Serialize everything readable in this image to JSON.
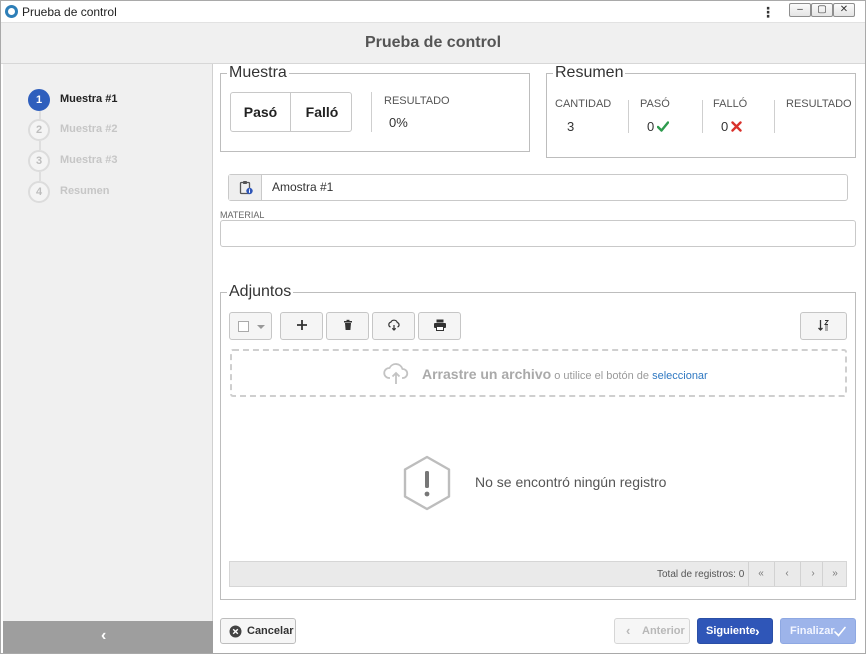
{
  "window": {
    "title": "Prueba de control"
  },
  "header": {
    "title": "Prueba de control"
  },
  "steps": [
    {
      "number": "1",
      "label": "Muestra #1"
    },
    {
      "number": "2",
      "label": "Muestra #2"
    },
    {
      "number": "3",
      "label": "Muestra #3"
    },
    {
      "number": "4",
      "label": "Resumen"
    }
  ],
  "muestra": {
    "legend": "Muestra",
    "pass_label": "Pasó",
    "fail_label": "Falló",
    "result_caption": "RESULTADO",
    "result_value": "0%"
  },
  "resumen": {
    "legend": "Resumen",
    "cantidad_caption": "CANTIDAD",
    "cantidad_value": "3",
    "paso_caption": "PASÓ",
    "paso_value": "0",
    "fallo_caption": "FALLÓ",
    "fallo_value": "0",
    "resultado_caption": "RESULTADO"
  },
  "sample_name": {
    "value": "Amostra #1"
  },
  "material": {
    "label": "MATERIAL",
    "value": ""
  },
  "adjuntos": {
    "legend": "Adjuntos",
    "dropzone_strong": "Arrastre un archivo",
    "dropzone_middle": " o utilice el botón de ",
    "dropzone_link": "seleccionar",
    "empty_message": "No se encontró ningún registro",
    "total_label": "Total de registros: 0",
    "pager": [
      "«",
      "‹",
      "›",
      "»"
    ]
  },
  "buttons": {
    "cancel": "Cancelar",
    "previous": "Anterior",
    "next": "Siguiente",
    "finish": "Finalizar"
  },
  "colors": {
    "accent": "#2f56b8",
    "success": "#2e9b4e",
    "danger": "#d9312b",
    "link": "#2f78c2"
  },
  "icons": {
    "app": "app-icon",
    "menu": "kebab-menu-icon",
    "clipboard": "clipboard-info-icon",
    "add": "plus-icon",
    "delete": "trash-icon",
    "cloud": "cloud-icon",
    "print": "print-icon",
    "sort": "sort-icon",
    "upload": "cloud-upload-icon",
    "warning": "warning-hexagon-icon"
  }
}
